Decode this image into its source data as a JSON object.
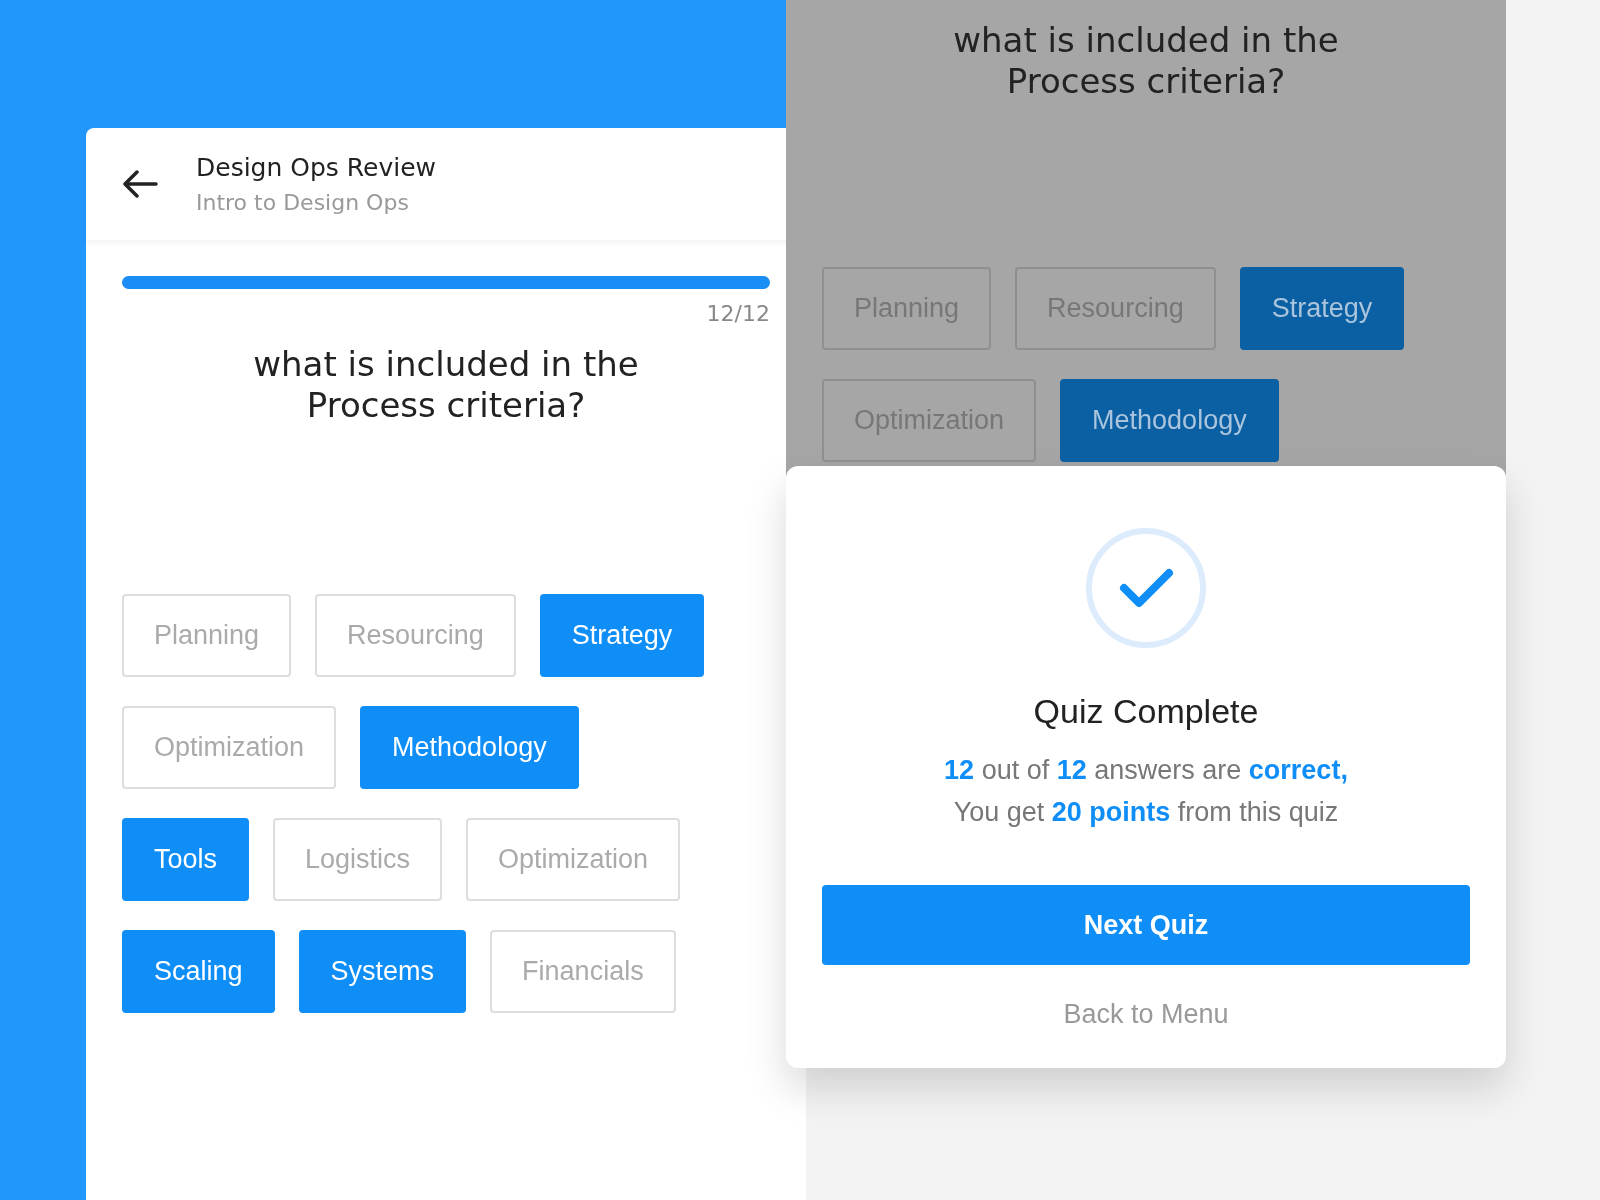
{
  "left_screen": {
    "header": {
      "title": "Design Ops Review",
      "subtitle": "Intro to Design Ops"
    },
    "progress": {
      "level": 1,
      "label": "12/12"
    },
    "question": "what is included in the Process criteria?",
    "options": [
      {
        "label": "Planning",
        "selected": false
      },
      {
        "label": "Resourcing",
        "selected": false
      },
      {
        "label": "Strategy",
        "selected": true
      },
      {
        "label": "Optimization",
        "selected": false
      },
      {
        "label": "Methodology",
        "selected": true
      },
      {
        "label": "Tools",
        "selected": true
      },
      {
        "label": "Logistics",
        "selected": false
      },
      {
        "label": "Optimization",
        "selected": false
      },
      {
        "label": "Scaling",
        "selected": true
      },
      {
        "label": "Systems",
        "selected": true
      },
      {
        "label": "Financials",
        "selected": false
      }
    ]
  },
  "right_screen": {
    "question": "what is included in the Process criteria?",
    "options": [
      {
        "label": "Planning",
        "selected": false
      },
      {
        "label": "Resourcing",
        "selected": false
      },
      {
        "label": "Strategy",
        "selected": true
      },
      {
        "label": "Optimization",
        "selected": false
      },
      {
        "label": "Methodology",
        "selected": true
      }
    ],
    "dialog": {
      "title": "Quiz Complete",
      "message_lines": [
        "**12** out of **12** answers are **correct,**",
        "You get **20 points** from this quiz"
      ],
      "primary_button": "Next Quiz",
      "secondary_link": "Back to Menu"
    }
  }
}
